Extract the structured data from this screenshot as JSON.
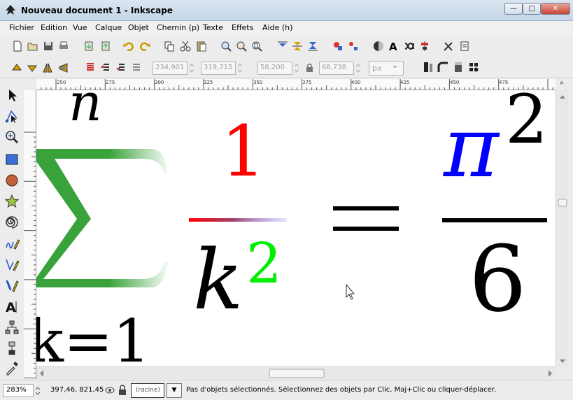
{
  "window": {
    "title": "Nouveau document 1 - Inkscape",
    "controls": {
      "minimize": "—",
      "maximize": "□",
      "close": "✕"
    }
  },
  "menu": [
    {
      "label": "Fichier"
    },
    {
      "label": "Edition"
    },
    {
      "label": "Vue"
    },
    {
      "label": "Calque"
    },
    {
      "label": "Objet"
    },
    {
      "label": "Chemin (p)"
    },
    {
      "label": "Texte"
    },
    {
      "label": "Effets"
    },
    {
      "label": "Aide (h)"
    }
  ],
  "toolbar1": {
    "icons": [
      "new-document-icon",
      "open-icon",
      "save-icon",
      "print-icon",
      "import-icon",
      "export-icon",
      "undo-icon",
      "redo-icon",
      "duplicate-icon",
      "cut-icon",
      "paste-icon",
      "zoom-selection-icon",
      "zoom-drawing-icon",
      "zoom-page-icon",
      "align-top-icon",
      "align-middle-icon",
      "align-bottom-icon",
      "group-icon",
      "ungroup-icon",
      "fill-stroke-icon",
      "text-font-icon",
      "xml-editor-icon",
      "align-distribute-icon",
      "preferences-icon",
      "document-properties-icon"
    ]
  },
  "toolbar2": {
    "x_value": "234,901",
    "y_value": "319,715",
    "w_value": "58,200",
    "h_value": "68,738",
    "unit": "px"
  },
  "rulers": {
    "h_labels": [
      "250",
      "275",
      "300",
      "325",
      "350",
      "375",
      "400",
      "425",
      "450",
      "475"
    ]
  },
  "formula": {
    "upper": "n",
    "lower": "k=1",
    "numerator_left": "1",
    "denominator_base": "k",
    "denominator_exp": "2",
    "equals": "=",
    "pi": "π",
    "pi_exp": "2",
    "denominator_right": "6",
    "colors": {
      "red": "#ff0000",
      "green": "#00ee00",
      "blue": "#0000ff",
      "sigma_green": "#3aa23a",
      "black": "#000000"
    }
  },
  "statusbar": {
    "zoom": "283%",
    "coords": "397,46, 821,45",
    "layer": "(racine)",
    "message": "Pas d'objets sélectionnés. Sélectionnez des objets par Clic, Maj+Clic ou cliquer-déplacer."
  }
}
